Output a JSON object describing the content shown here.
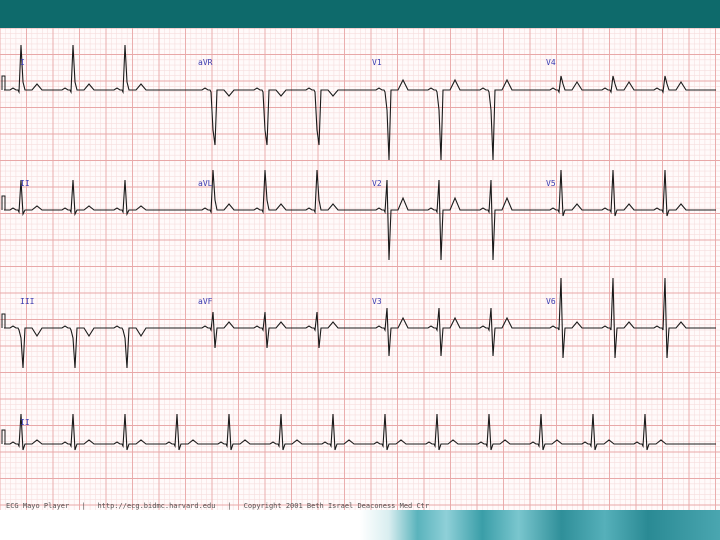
{
  "leads": [
    {
      "id": "I",
      "label": "I"
    },
    {
      "id": "aVR",
      "label": "aVR"
    },
    {
      "id": "V1",
      "label": "V1"
    },
    {
      "id": "V4",
      "label": "V4"
    },
    {
      "id": "II",
      "label": "II"
    },
    {
      "id": "aVL",
      "label": "aVL"
    },
    {
      "id": "V2",
      "label": "V2"
    },
    {
      "id": "V5",
      "label": "V5"
    },
    {
      "id": "III",
      "label": "III"
    },
    {
      "id": "aVF",
      "label": "aVF"
    },
    {
      "id": "V3",
      "label": "V3"
    },
    {
      "id": "V6",
      "label": "V6"
    },
    {
      "id": "II-rhythm",
      "label": "II"
    }
  ],
  "footer": {
    "left": "ECG Mayo Player",
    "middle": "http://ecg.bidmc.harvard.edu",
    "right": "Copyright 2001 Beth Israel Deaconess Med Ctr"
  },
  "colors": {
    "header": "#0e6a6b",
    "grid_major": "#e8a8a8",
    "grid_minor": "#f6dede",
    "trace": "#1a1a1a",
    "label": "#3a3ab0"
  }
}
